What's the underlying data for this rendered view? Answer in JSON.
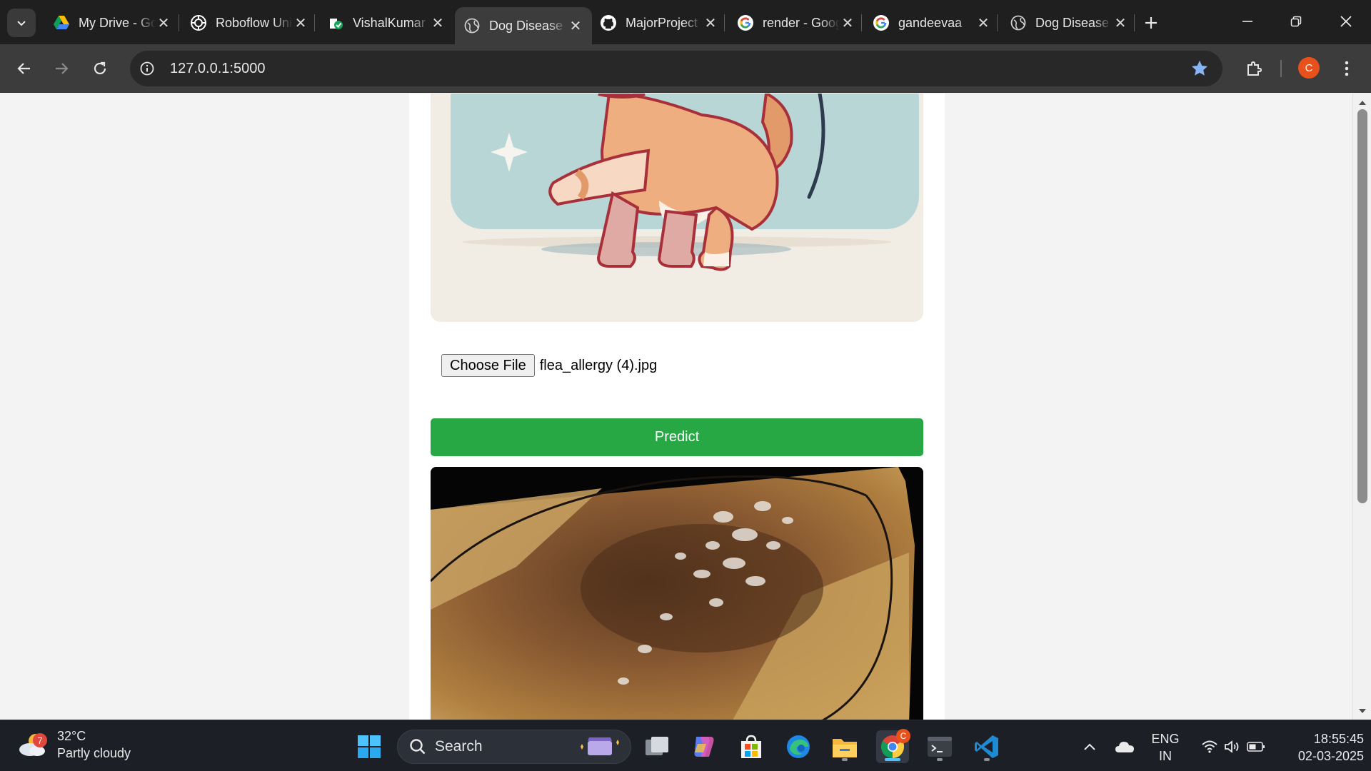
{
  "browser": {
    "tabs": [
      {
        "title": "My Drive - Google Drive",
        "icon": "google-drive-icon"
      },
      {
        "title": "Roboflow Universe",
        "icon": "roboflow-icon"
      },
      {
        "title": "VishalKumar",
        "icon": "verified-icon"
      },
      {
        "title": "Dog Disease",
        "icon": "globe-icon",
        "active": true
      },
      {
        "title": "MajorProject",
        "icon": "github-icon"
      },
      {
        "title": "render - Google Search",
        "icon": "google-icon"
      },
      {
        "title": "gandeevaa",
        "icon": "google-icon"
      },
      {
        "title": "Dog Disease",
        "icon": "globe-icon"
      }
    ],
    "url": "127.0.0.1:5000",
    "profile_initial": "C"
  },
  "page": {
    "file_button_label": "Choose File",
    "file_name": "flea_allergy (4).jpg",
    "predict_label": "Predict"
  },
  "taskbar": {
    "weather_badge": "7",
    "temperature": "32°C",
    "condition": "Partly cloudy",
    "search_label": "Search",
    "language": "ENG",
    "region": "IN",
    "time": "18:55:45",
    "date": "02-03-2025",
    "chrome_badge": "C"
  },
  "colors": {
    "predict": "#28a745",
    "accent": "#8ab4f8",
    "profile": "#e8501c"
  }
}
